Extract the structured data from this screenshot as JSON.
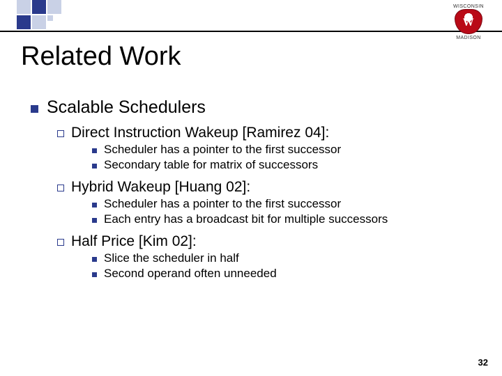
{
  "title": "Related Work",
  "logo": {
    "top": "WISCONSIN",
    "bottom": "MADISON"
  },
  "lvl1": "Scalable Schedulers",
  "sections": [
    {
      "heading": "Direct Instruction Wakeup [Ramirez 04]:",
      "items": [
        "Scheduler has a pointer to the first successor",
        "Secondary table for matrix of successors"
      ]
    },
    {
      "heading": "Hybrid Wakeup [Huang 02]:",
      "items": [
        "Scheduler has a pointer to the first successor",
        "Each entry has a broadcast bit for multiple successors"
      ]
    },
    {
      "heading": "Half Price [Kim 02]:",
      "items": [
        "Slice the scheduler in half",
        "Second operand often unneeded"
      ]
    }
  ],
  "page_number": "32"
}
